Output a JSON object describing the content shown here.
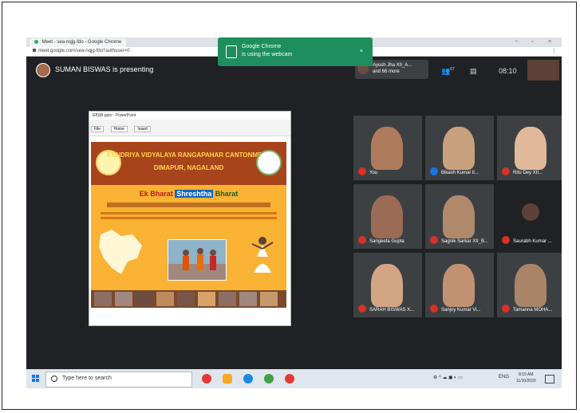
{
  "browser": {
    "tab_title": "Meet - sea-nqjg-fdo - Google Chrome",
    "url": "meet.google.com/sea-nqjg-fdo?authuser=0",
    "minimize": "−",
    "maximize": "▫",
    "close": "×",
    "menu": "⋮"
  },
  "toast": {
    "title": "Google Chrome",
    "message": "is using the webcam",
    "close": "×"
  },
  "meet": {
    "presenting": "SUMAN BISWAS is presenting",
    "participant_line1": "Ayush Jha XII_A...",
    "participant_line2": "and 66 more",
    "people_count": "67",
    "clock": "08:10"
  },
  "slide": {
    "window_title": "EBSB.pptx - PowerPoint",
    "toolbar": [
      "File",
      "Home",
      "Insert"
    ],
    "banner_line1": "KENDRIYA VIDYALAYA RANGAPAHAR CANTONMENT",
    "banner_line2": "DIMAPUR, NAGALAND",
    "ebsb_w1": "Ek Bharat",
    "ebsb_w2": "Shreshtha",
    "ebsb_w3": "Bharat"
  },
  "participants": [
    {
      "name": "You",
      "skin": "#b07a5c",
      "muted": true
    },
    {
      "name": "Bikash Kumar ll...",
      "skin": "#c8a27e",
      "muted": false
    },
    {
      "name": "Ritu Dey XII...",
      "skin": "#e0b89a",
      "muted": true
    },
    {
      "name": "Sangeeta Gupta",
      "skin": "#9c6b55",
      "muted": true
    },
    {
      "name": "Sagnik Sarkar XII_B...",
      "skin": "#b0896a",
      "muted": true
    },
    {
      "name": "Saurabh Kumar ...",
      "skin": "#5d4037",
      "muted": true
    },
    {
      "name": "SARAH BISWAS X...",
      "skin": "#d2a585",
      "muted": true
    },
    {
      "name": "Sanjoy Kumar Vi...",
      "skin": "#c09272",
      "muted": true
    },
    {
      "name": "Tamanna MOHA...",
      "skin": "#a98468",
      "muted": true
    }
  ],
  "taskbar": {
    "search_placeholder": "Type here to search",
    "tray_icons": "⚙ ^ ☁ ◼ ◐ ▭",
    "lang": "ENG",
    "time": "8:10 AM",
    "date": "11/10/2020"
  },
  "colors": {
    "meet_bg": "#202124",
    "toast_bg": "#1e8e5e",
    "mic_off": "#d93025",
    "banner": "#a7441c",
    "slide_yellow": "#f9b233"
  }
}
